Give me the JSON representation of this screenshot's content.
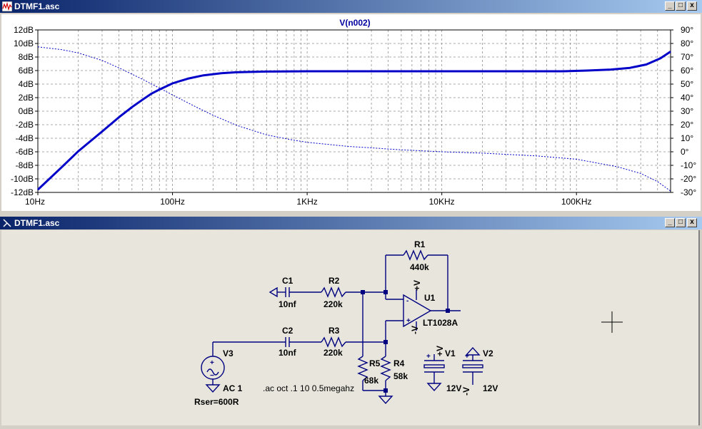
{
  "plot_window": {
    "title": "DTMF1.asc",
    "trace_label": "V(n002)"
  },
  "schematic_window": {
    "title": "DTMF1.asc"
  },
  "window_buttons": {
    "minimize": "_",
    "maximize": "□",
    "close": "x"
  },
  "chart_data": {
    "type": "line",
    "title": "V(n002)",
    "x_scale": "log",
    "xlim": [
      10,
      500000
    ],
    "x_ticks": [
      {
        "value": 10,
        "label": "10Hz"
      },
      {
        "value": 100,
        "label": "100Hz"
      },
      {
        "value": 1000,
        "label": "1KHz"
      },
      {
        "value": 10000,
        "label": "10KHz"
      },
      {
        "value": 100000,
        "label": "100KHz"
      }
    ],
    "y_left": {
      "ylim": [
        -12,
        12
      ],
      "labels": [
        "12dB",
        "10dB",
        "8dB",
        "6dB",
        "4dB",
        "2dB",
        "0dB",
        "-2dB",
        "-4dB",
        "-6dB",
        "-8dB",
        "-10dB",
        "-12dB"
      ]
    },
    "y_right": {
      "ylim": [
        -30,
        90
      ],
      "labels": [
        "90°",
        "80°",
        "70°",
        "60°",
        "50°",
        "40°",
        "30°",
        "20°",
        "10°",
        "0°",
        "-10°",
        "-20°",
        "-30°"
      ]
    },
    "grid": true,
    "series": [
      {
        "axis": "left",
        "style": "solid",
        "color": "#0000c8",
        "points": [
          [
            10,
            -11.6
          ],
          [
            15,
            -8.3
          ],
          [
            20,
            -5.9
          ],
          [
            30,
            -3.0
          ],
          [
            40,
            -0.9
          ],
          [
            50,
            0.6
          ],
          [
            60,
            1.7
          ],
          [
            70,
            2.6
          ],
          [
            80,
            3.2
          ],
          [
            100,
            4.1
          ],
          [
            130,
            4.8
          ],
          [
            170,
            5.3
          ],
          [
            230,
            5.6
          ],
          [
            300,
            5.75
          ],
          [
            500,
            5.85
          ],
          [
            1000,
            5.9
          ],
          [
            10000,
            5.9
          ],
          [
            80000,
            5.9
          ],
          [
            120000,
            6.0
          ],
          [
            180000,
            6.15
          ],
          [
            250000,
            6.4
          ],
          [
            330000,
            6.9
          ],
          [
            420000,
            7.8
          ],
          [
            500000,
            8.8
          ]
        ]
      },
      {
        "axis": "right",
        "style": "dashed",
        "color": "#0000c8",
        "points": [
          [
            10,
            77.5
          ],
          [
            15,
            75.5
          ],
          [
            20,
            73
          ],
          [
            30,
            67.5
          ],
          [
            40,
            62
          ],
          [
            60,
            53.5
          ],
          [
            80,
            47
          ],
          [
            100,
            42
          ],
          [
            150,
            33
          ],
          [
            200,
            27
          ],
          [
            300,
            19.5
          ],
          [
            500,
            12.5
          ],
          [
            800,
            8.5
          ],
          [
            1000,
            7
          ],
          [
            2000,
            4
          ],
          [
            5000,
            1.5
          ],
          [
            10000,
            0
          ],
          [
            20000,
            -1
          ],
          [
            50000,
            -3
          ],
          [
            100000,
            -5.5
          ],
          [
            200000,
            -11
          ],
          [
            300000,
            -16
          ],
          [
            400000,
            -22
          ],
          [
            500000,
            -29
          ]
        ]
      }
    ]
  },
  "schematic": {
    "components": [
      {
        "ref": "C1",
        "value": "10nf"
      },
      {
        "ref": "R2",
        "value": "220k"
      },
      {
        "ref": "C2",
        "value": "10nf"
      },
      {
        "ref": "R3",
        "value": "220k"
      },
      {
        "ref": "R1",
        "value": "440k"
      },
      {
        "ref": "R4",
        "value": "58k"
      },
      {
        "ref": "R5",
        "value": "68k"
      },
      {
        "ref": "U1",
        "value": "LT1028A"
      },
      {
        "ref": "V1",
        "value": "12V"
      },
      {
        "ref": "V2",
        "value": "12V"
      },
      {
        "ref": "V3",
        "value": "AC 1"
      }
    ],
    "v3_extra": "Rser=600R",
    "directive": ".ac oct .1 10 0.5megahz",
    "pin_plus_v": "+V",
    "pin_minus_v": "-V",
    "opamp_plus": "+",
    "opamp_minus": "-",
    "label_plus": "+",
    "source_plus": "+",
    "source_minus": "−"
  }
}
